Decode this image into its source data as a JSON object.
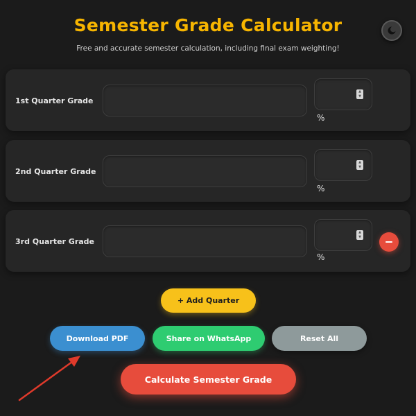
{
  "header": {
    "title": "Semester Grade Calculator",
    "subtitle": "Free and accurate semester calculation, including final exam weighting!",
    "theme_toggle_icon": "moon-icon"
  },
  "colors": {
    "background": "#1b1b1b",
    "title": "#f7b500",
    "card": "#262626",
    "add": "#f7c11a",
    "pdf": "#3b8fd0",
    "whatsapp": "#2ecc71",
    "reset": "#8e9a9b",
    "calculate": "#e74c3c",
    "annotation_arrow": "#e03a2b"
  },
  "quarters": [
    {
      "label": "1st Quarter Grade",
      "grade": "",
      "weight": "",
      "percent_sign": "%",
      "removable": false
    },
    {
      "label": "2nd Quarter Grade",
      "grade": "",
      "weight": "",
      "percent_sign": "%",
      "removable": false
    },
    {
      "label": "3rd Quarter Grade",
      "grade": "",
      "weight": "",
      "percent_sign": "%",
      "removable": true
    }
  ],
  "actions": {
    "add_quarter": "+ Add Quarter",
    "download_pdf": "Download PDF",
    "share_whatsapp": "Share on WhatsApp",
    "reset_all": "Reset All",
    "calculate": "Calculate Semester Grade"
  }
}
